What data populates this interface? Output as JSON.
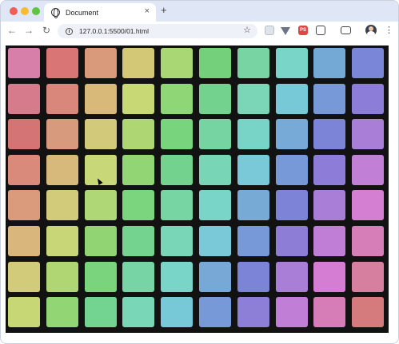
{
  "browser": {
    "tab_title": "Document",
    "tab_close": "×",
    "new_tab": "+",
    "url": "127.0.0.1:5500/01.html",
    "back": "←",
    "forward": "→",
    "reload": "↻",
    "bookmark": "☆",
    "menu": "⋮",
    "extension_badge": "PS"
  },
  "tiles": {
    "rows": [
      [
        "#d77fa8",
        "#d97575",
        "#d99a7c",
        "#d2c876",
        "#a8d773",
        "#74d07b",
        "#78d4a2",
        "#78d5c7",
        "#74a9d6",
        "#7a86d8"
      ],
      [
        "#d67b8c",
        "#d9877a",
        "#d8b97a",
        "#c8d875",
        "#8fd677",
        "#73d28d",
        "#7ad6b7",
        "#78c9d8",
        "#7799d8",
        "#8c7dd8"
      ],
      [
        "#d57474",
        "#d79a7d",
        "#d2c97a",
        "#aed773",
        "#79d47e",
        "#76d3a2",
        "#78d4c6",
        "#77aad6",
        "#7c84d7",
        "#a87ed6"
      ],
      [
        "#d98a7b",
        "#d8b97c",
        "#c8d777",
        "#91d574",
        "#73d38e",
        "#78d6b6",
        "#79c9d8",
        "#7799d7",
        "#8e7dd8",
        "#c17fd6"
      ],
      [
        "#d99b7c",
        "#d2cb79",
        "#b0d775",
        "#7bd47e",
        "#77d4a3",
        "#78d5c8",
        "#78aad6",
        "#7d84d7",
        "#a97ed6",
        "#d47fd2"
      ],
      [
        "#d9b67c",
        "#c9d677",
        "#91d474",
        "#74d38f",
        "#79d6b7",
        "#79c9d8",
        "#7899d7",
        "#8e7dd7",
        "#c17ed6",
        "#d67eb7"
      ],
      [
        "#d2cb79",
        "#b0d674",
        "#7ad47e",
        "#77d4a4",
        "#78d5c7",
        "#78a9d6",
        "#7c84d7",
        "#a97ed6",
        "#d47dd3",
        "#d77f9e"
      ],
      [
        "#c7d776",
        "#92d574",
        "#73d390",
        "#79d6b7",
        "#78c9d8",
        "#7899d7",
        "#8d7ed7",
        "#c07ed6",
        "#d67db7",
        "#d57a7d"
      ]
    ]
  }
}
